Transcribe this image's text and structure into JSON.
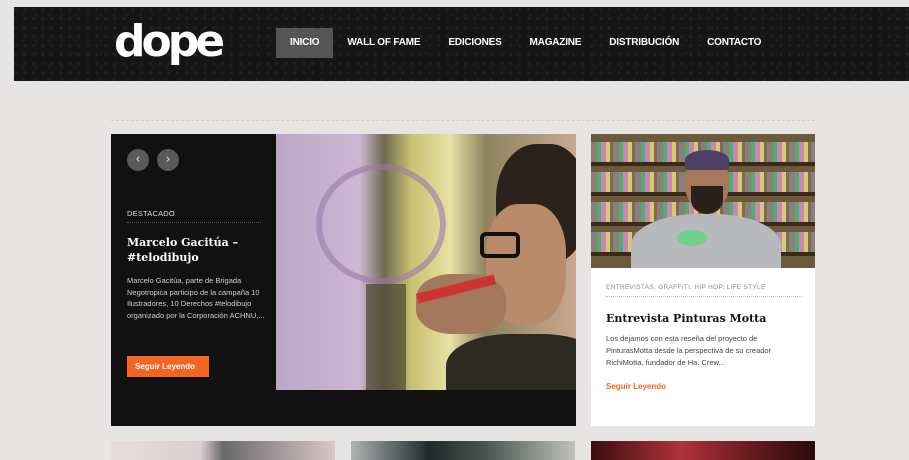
{
  "brand": {
    "logo_text": "dope"
  },
  "nav": {
    "items": [
      {
        "label": "INICIO",
        "active": true
      },
      {
        "label": "WALL OF FAME",
        "active": false
      },
      {
        "label": "EDICIONES",
        "active": false
      },
      {
        "label": "MAGAZINE",
        "active": false
      },
      {
        "label": "DISTRIBUCIÓN",
        "active": false
      },
      {
        "label": "CONTACTO",
        "active": false
      }
    ]
  },
  "featured": {
    "prev_icon": "‹",
    "next_icon": "›",
    "tag": "DESTACADO",
    "title": "Marcelo Gacitúa – #telodibujo",
    "excerpt": "Marcelo Gacitúa, parte de Brigada Negotropica participo de la campaña 10 Ilustradores, 10 Derechos #telodibujo organizado por la Corporación ACHNU,...",
    "button_label": "Seguir Leyendo"
  },
  "card": {
    "categories": "ENTREVISTAS, GRAFFITI, HIP HOP, LIFE STYLE",
    "title": "Entrevista Pinturas Motta",
    "excerpt": "Los dejamos con esta reseña del proyecto de PinturasMotta desde la perspectiva de su creador RichiMotta, fundador de Ha. Crew...",
    "link_label": "Seguir Leyendo"
  },
  "colors": {
    "accent": "#f26522",
    "header_bg": "#151515",
    "page_bg": "#e6e5e3"
  }
}
